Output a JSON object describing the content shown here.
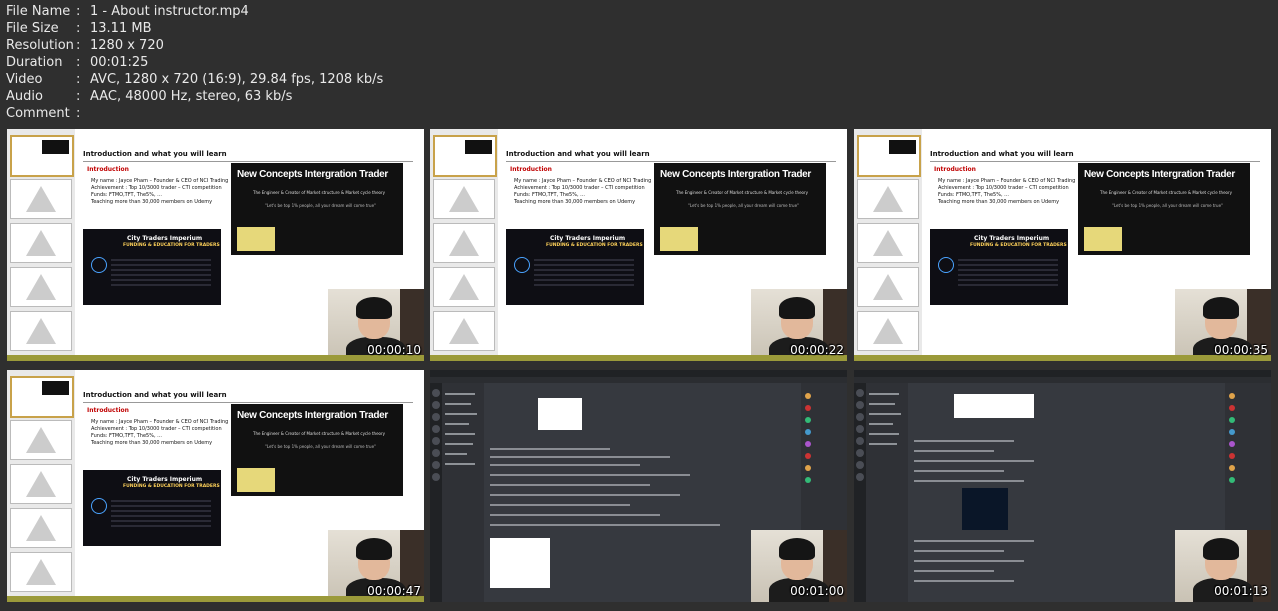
{
  "file_info": [
    {
      "key": "File Name",
      "value": "1 - About instructor.mp4"
    },
    {
      "key": "File Size",
      "value": "13.11 MB"
    },
    {
      "key": "Resolution",
      "value": "1280 x 720"
    },
    {
      "key": "Duration",
      "value": "00:01:25"
    },
    {
      "key": "Video",
      "value": "AVC, 1280 x 720 (16:9), 29.84 fps, 1208 kb/s"
    },
    {
      "key": "Audio",
      "value": "AAC, 48000 Hz, stereo, 63 kb/s"
    },
    {
      "key": "Comment",
      "value": ""
    }
  ],
  "separator": ":",
  "slide": {
    "title": "Introduction and what you will learn",
    "section": "Introduction",
    "bullets": [
      "My name : Jayce Pham – Founder & CEO of NCI Trading",
      "Achievement : Top 10/3000 trader – CTI competition",
      "Funds: FTMO,TFT, The5%, ...",
      "Teaching more than 30,000 members  on Udemy"
    ],
    "brand_title": "New Concepts Intergration Trader",
    "brand_subtitle": "The Engineer & Creator of Market structure & Market cycle theory",
    "brand_quote": "\"Let's be top 1% people, all your dream will come true\"",
    "cti_logo": "City Traders Imperium",
    "cti_tagline": "FUNDING & EDUCATION FOR TRADERS"
  },
  "thumbnails": [
    {
      "timestamp": "00:00:10",
      "kind": "slide"
    },
    {
      "timestamp": "00:00:22",
      "kind": "slide"
    },
    {
      "timestamp": "00:00:35",
      "kind": "slide"
    },
    {
      "timestamp": "00:00:47",
      "kind": "slide"
    },
    {
      "timestamp": "00:01:00",
      "kind": "discord"
    },
    {
      "timestamp": "00:01:13",
      "kind": "discord"
    }
  ]
}
